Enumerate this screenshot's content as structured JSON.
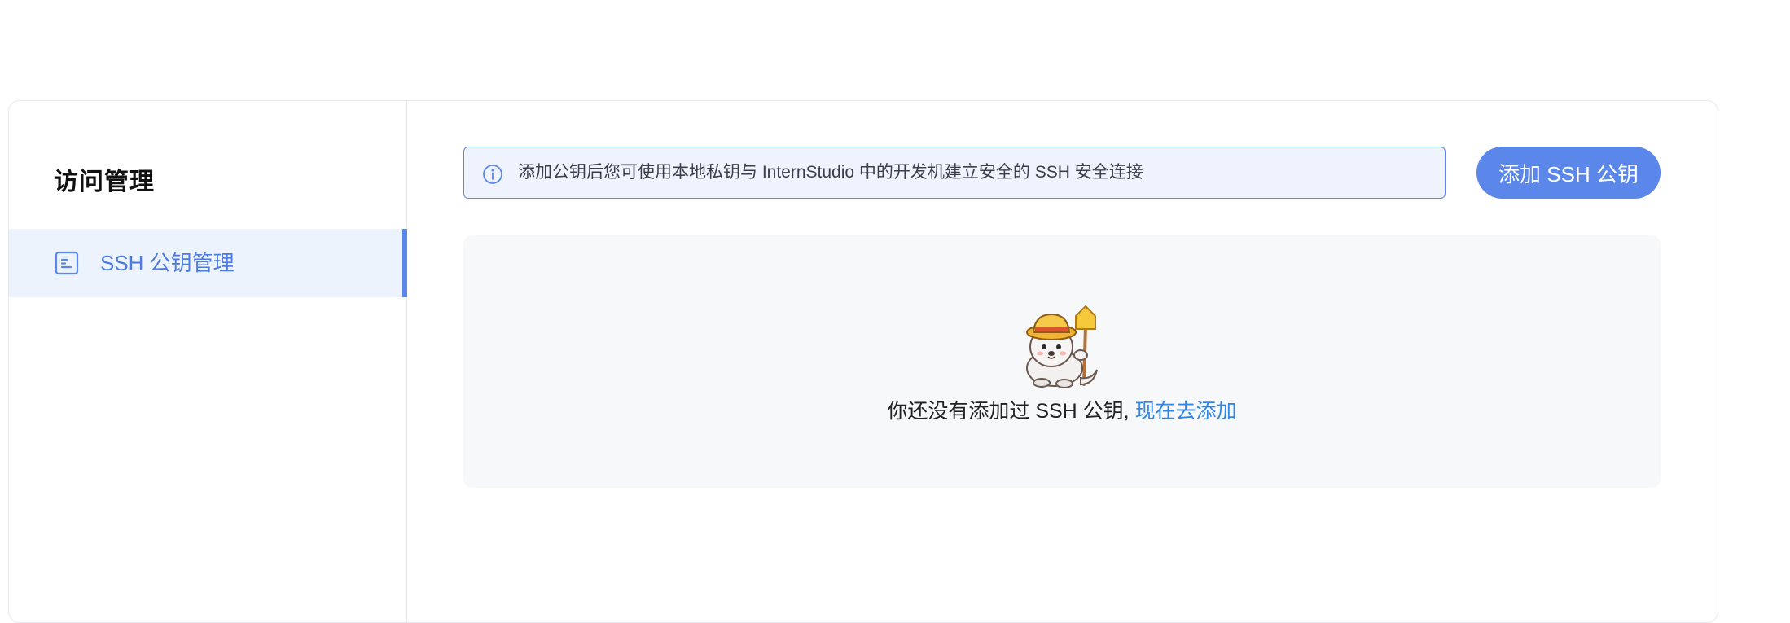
{
  "sidebar": {
    "title": "访问管理",
    "items": [
      {
        "label": "SSH 公钥管理",
        "icon": "document-list-icon",
        "active": true
      }
    ]
  },
  "main": {
    "notice": {
      "icon": "info-icon",
      "text": "添加公钥后您可使用本地私钥与 InternStudio 中的开发机建立安全的 SSH 安全连接"
    },
    "add_button_label": "添加 SSH 公钥",
    "empty_state": {
      "illustration": "seal-mascot-with-shovel",
      "message": "你还没有添加过 SSH 公钥,",
      "link_label": "现在去添加"
    }
  },
  "colors": {
    "accent": "#5b87ea",
    "link": "#2f86e8",
    "active_bg": "#edf3fd",
    "panel_bg": "#f7f8fa"
  }
}
